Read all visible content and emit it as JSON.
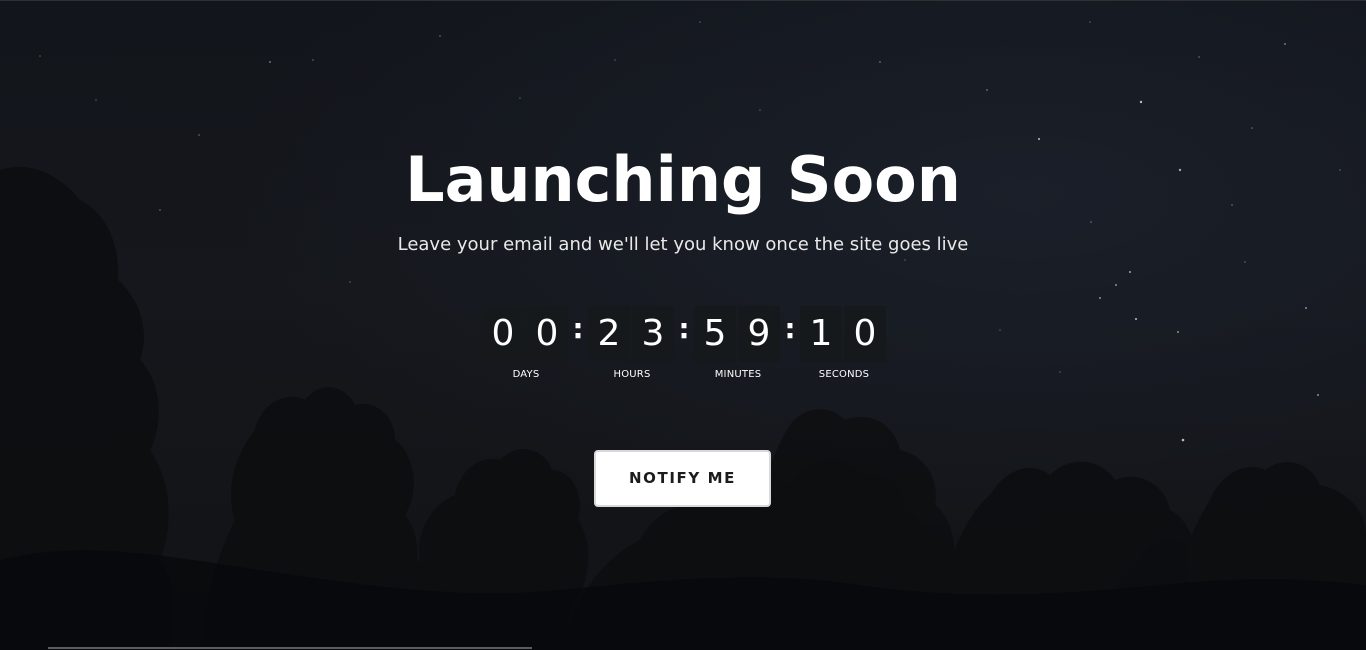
{
  "hero": {
    "title": "Launching Soon",
    "subtitle": "Leave your email and we'll let you know once the site goes live"
  },
  "countdown": {
    "separator": ":",
    "units": [
      {
        "label": "DAYS",
        "d1": "0",
        "d2": "0"
      },
      {
        "label": "HOURS",
        "d1": "2",
        "d2": "3"
      },
      {
        "label": "MINUTES",
        "d1": "5",
        "d2": "9"
      },
      {
        "label": "SECONDS",
        "d1": "1",
        "d2": "0"
      }
    ]
  },
  "cta": {
    "notify_label": "NOTIFY ME"
  },
  "colors": {
    "background": "#14161b",
    "text": "#ffffff",
    "digit_bg": "#15191c",
    "button_bg": "#ffffff",
    "button_text": "#1c1c1f"
  }
}
